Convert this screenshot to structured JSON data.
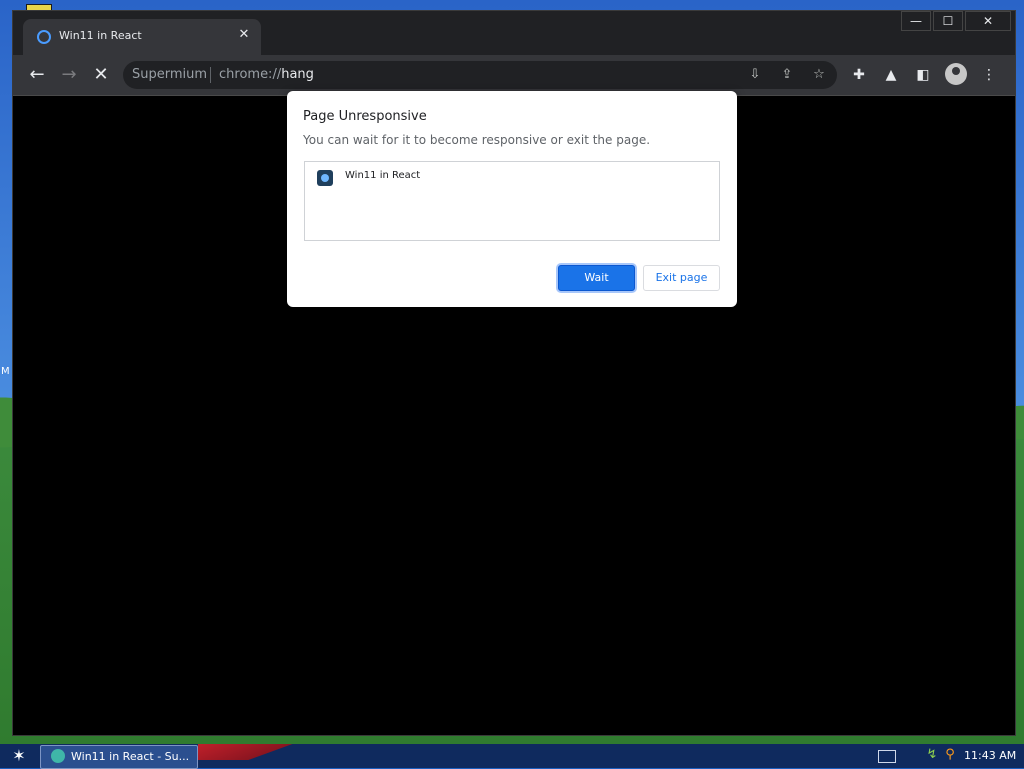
{
  "browser": {
    "tab": {
      "title": "Win11 in React",
      "close_icon": "close-icon"
    },
    "window_controls": {
      "minimize": "—",
      "maximize": "☐",
      "close": "✕"
    },
    "toolbar": {
      "back": "←",
      "forward": "→",
      "stop": "✕",
      "omnibox": {
        "site_name": "Supermium",
        "url_scheme": "chrome://",
        "url_host": "hang"
      }
    }
  },
  "dialog": {
    "title": "Page Unresponsive",
    "body": "You can wait for it to become responsive or exit the page.",
    "pages": [
      {
        "label": "Win11 in React"
      }
    ],
    "wait_label": "Wait",
    "exit_label": "Exit page"
  },
  "taskbar": {
    "task_label": "Win11 in React - Su...",
    "clock": "11:43 AM"
  },
  "desktop": {
    "edge_letter": "M"
  },
  "colors": {
    "accent": "#1a73e8",
    "toolbar": "#35363a",
    "titlebar": "#202124",
    "taskbar": "#0f2a5e"
  }
}
